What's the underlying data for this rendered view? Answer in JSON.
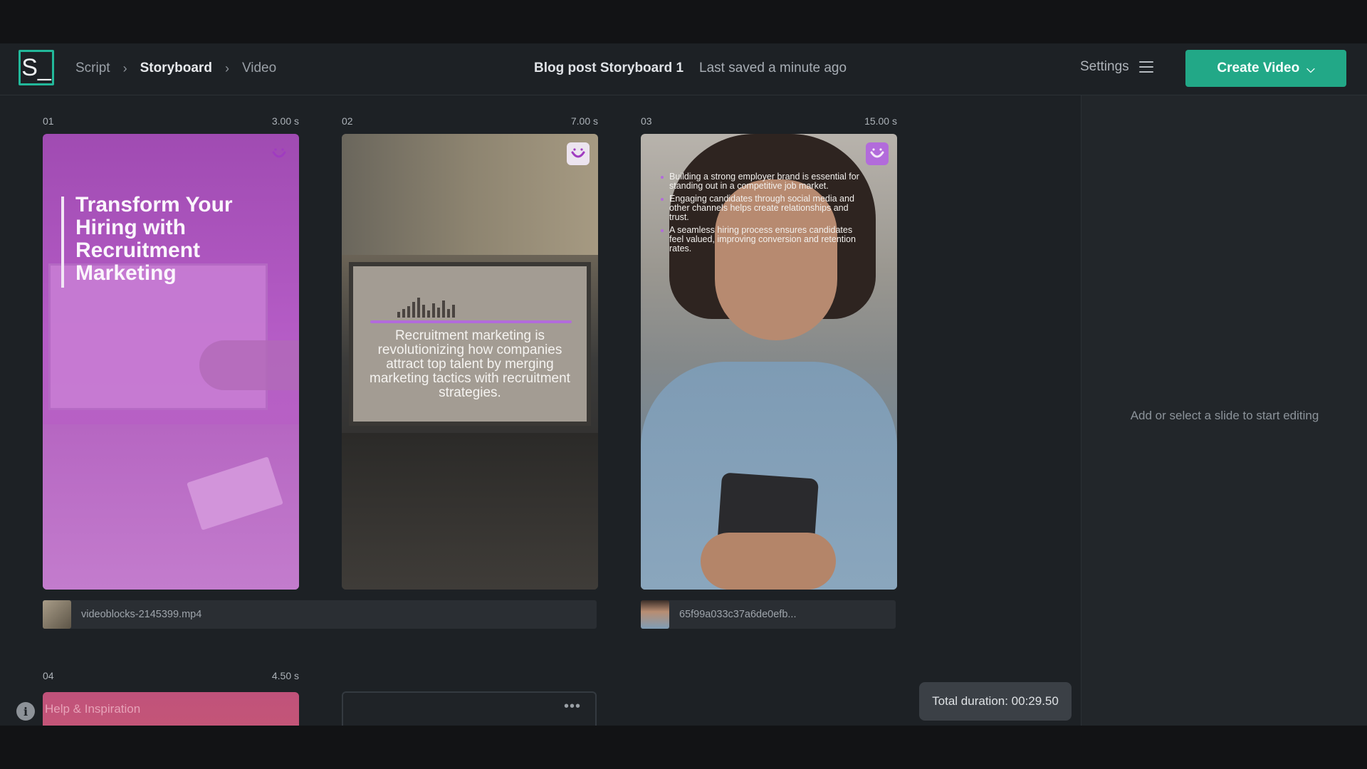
{
  "header": {
    "logo_text": "S_",
    "breadcrumb": {
      "script": "Script",
      "storyboard": "Storyboard",
      "video": "Video"
    },
    "doc_title": "Blog post Storyboard 1",
    "save_status": "Last saved a minute ago",
    "settings_label": "Settings",
    "create_button": "Create Video"
  },
  "slides": [
    {
      "number": "01",
      "duration": "3.00 s",
      "title": "Transform Your Hiring with Recruitment Marketing"
    },
    {
      "number": "02",
      "duration": "7.00 s",
      "text": "Recruitment marketing is revolutionizing how companies attract top talent by merging marketing tactics with recruitment strategies."
    },
    {
      "number": "03",
      "duration": "15.00 s",
      "bullets": [
        "Building a strong employer brand is essential for standing out in a competitive job market.",
        "Engaging candidates through social media and other channels helps create relationships and trust.",
        "A seamless hiring process ensures candidates feel valued, improving conversion and retention rates."
      ]
    },
    {
      "number": "04",
      "duration": "4.50 s"
    }
  ],
  "assets": [
    {
      "name": "videoblocks-2145399.mp4"
    },
    {
      "name": "65f99a033c37a6de0efb..."
    }
  ],
  "side_panel": {
    "empty_message": "Add or select a slide to start editing"
  },
  "help": {
    "label": "Help & Inspiration"
  },
  "footer": {
    "total_duration": "Total duration: 00:29.50"
  },
  "colors": {
    "accent": "#22a887",
    "brand_purple": "#b26bdb",
    "background": "#1d2125"
  },
  "icons": [
    "chevron-right-icon",
    "menu-icon",
    "chevron-down-icon",
    "smile-icon",
    "info-icon",
    "more-icon"
  ]
}
